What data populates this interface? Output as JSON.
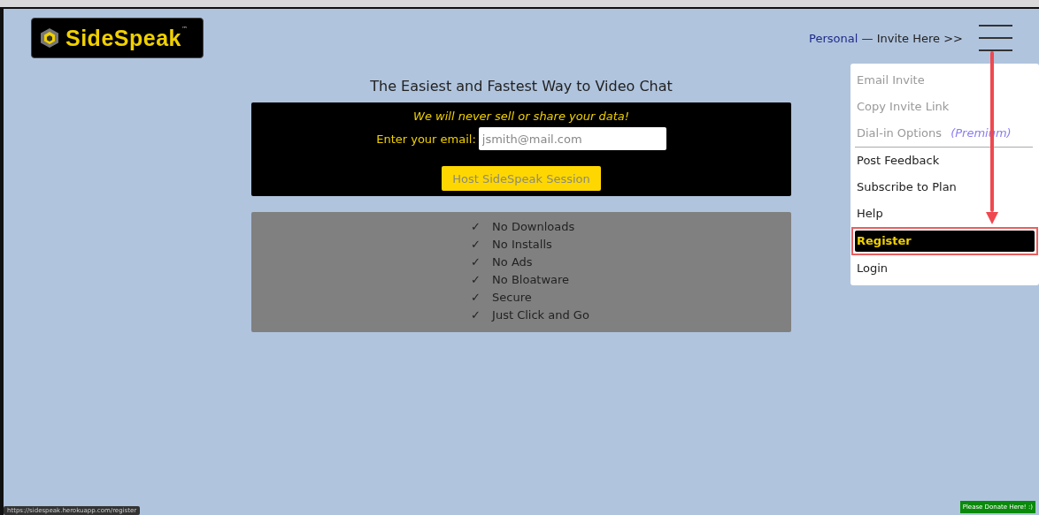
{
  "logo": {
    "name": "SideSpeak",
    "mark": "™"
  },
  "header": {
    "account": "Personal",
    "invite": "— Invite Here >>"
  },
  "headline": "The Easiest and Fastest Way to Video Chat",
  "signup": {
    "notice": "We will never sell or share your data!",
    "email_label": "Enter your email:",
    "email_placeholder": "jsmith@mail.com",
    "button": "Host SideSpeak Session"
  },
  "features": [
    {
      "check": "✓",
      "text": "No Downloads"
    },
    {
      "check": "✓",
      "text": "No Installs"
    },
    {
      "check": "✓",
      "text": "No Ads"
    },
    {
      "check": "✓",
      "text": "No Bloatware"
    },
    {
      "check": "✓",
      "text": "Secure"
    },
    {
      "check": "✓",
      "text": "Just Click and Go"
    }
  ],
  "menu": {
    "sections": [
      [
        {
          "label": "Email Invite",
          "disabled": true,
          "selected": false
        },
        {
          "label": "Copy Invite Link",
          "disabled": true,
          "selected": false
        },
        {
          "label": "Dial-in Options",
          "badge": "(Premium)",
          "disabled": true,
          "selected": false
        }
      ],
      [
        {
          "label": "Post Feedback",
          "disabled": false,
          "selected": false
        },
        {
          "label": "Subscribe to Plan",
          "disabled": false,
          "selected": false
        },
        {
          "label": "Help",
          "disabled": false,
          "selected": false
        },
        {
          "label": "Register",
          "disabled": false,
          "selected": true
        },
        {
          "label": "Login",
          "disabled": false,
          "selected": false
        }
      ]
    ]
  },
  "status_url": "https://sidespeak.herokuapp.com/register",
  "donate_button": "Please Donate Here! :)"
}
